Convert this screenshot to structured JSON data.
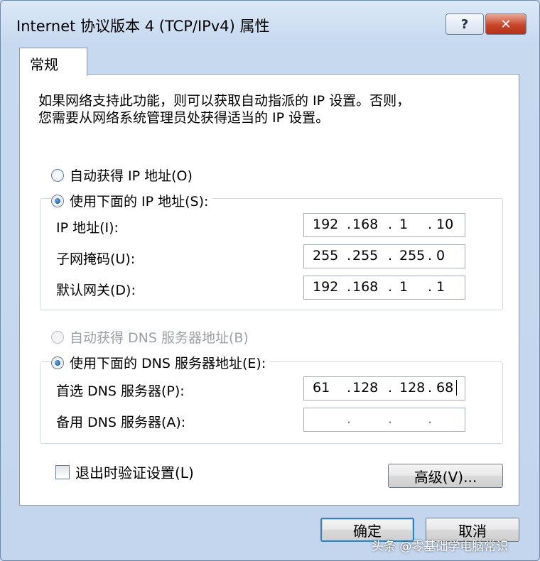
{
  "window": {
    "title": "Internet 协议版本 4 (TCP/IPv4) 属性",
    "help_label": "?",
    "close_label": "✕"
  },
  "tab": {
    "label": "常规"
  },
  "description": {
    "line1": "如果网络支持此功能，则可以获取自动指派的 IP 设置。否则，",
    "line2": "您需要从网络系统管理员处获得适当的 IP 设置。"
  },
  "ip_mode": {
    "auto_label": "自动获得 IP 地址(O)",
    "manual_label": "使用下面的 IP 地址(S):",
    "selected": "manual"
  },
  "ip_fields": [
    {
      "label": "IP 地址(I):",
      "octets": [
        "192",
        "168",
        "1",
        "10"
      ]
    },
    {
      "label": "子网掩码(U):",
      "octets": [
        "255",
        "255",
        "255",
        "0"
      ]
    },
    {
      "label": "默认网关(D):",
      "octets": [
        "192",
        "168",
        "1",
        "1"
      ]
    }
  ],
  "dns_mode": {
    "auto_label": "自动获得 DNS 服务器地址(B)",
    "manual_label": "使用下面的 DNS 服务器地址(E):",
    "selected": "manual",
    "auto_disabled": true
  },
  "dns_fields": [
    {
      "label": "首选 DNS 服务器(P):",
      "octets": [
        "61",
        "128",
        "128",
        "68"
      ]
    },
    {
      "label": "备用 DNS 服务器(A):",
      "octets": [
        "",
        "",
        "",
        ""
      ]
    }
  ],
  "validate_on_exit": {
    "label": "退出时验证设置(L)",
    "checked": false
  },
  "buttons": {
    "advanced": "高级(V)...",
    "ok": "确定",
    "cancel": "取消"
  },
  "watermark": "头条 @零基础学电脑常识",
  "colors": {
    "close_button": "#c8452a",
    "default_button_border": "#3c7fb1"
  }
}
